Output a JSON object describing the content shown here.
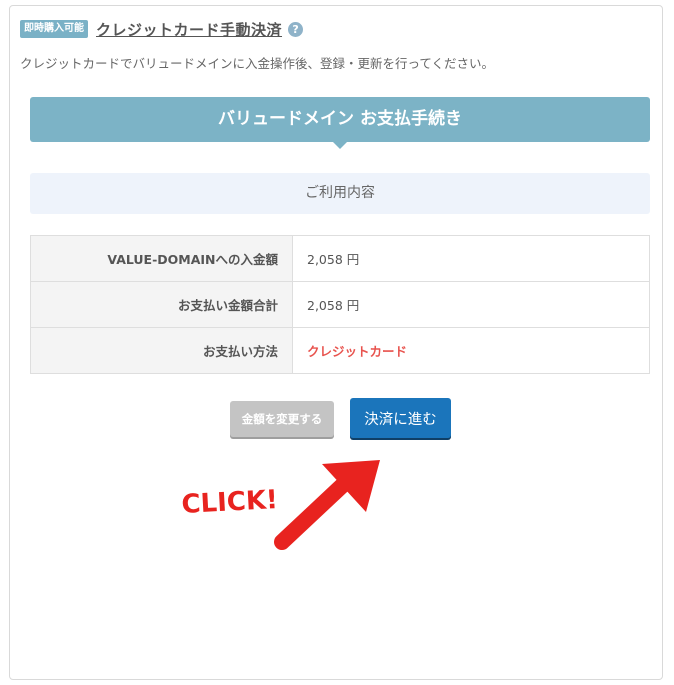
{
  "header": {
    "badge": "即時購入可能",
    "title": "クレジットカード手動決済",
    "help": "?"
  },
  "description": "クレジットカードでバリュードメインに入金操作後、登録・更新を行ってください。",
  "banner": {
    "title": "バリュードメイン お支払手続き"
  },
  "section": {
    "title": "ご利用内容"
  },
  "table": {
    "rows": [
      {
        "label": "VALUE-DOMAINへの入金額",
        "value": "2,058 円"
      },
      {
        "label": "お支払い金額合計",
        "value": "2,058 円"
      },
      {
        "label": "お支払い方法",
        "value": "クレジットカード"
      }
    ]
  },
  "buttons": {
    "change_amount": "金額を変更する",
    "proceed": "決済に進む"
  },
  "annotation": {
    "text": "CLICK!"
  },
  "colors": {
    "badge": "#7ab1c6",
    "banner": "#7cb3c6",
    "section_bg": "#eef3fb",
    "primary_button": "#1b75bb",
    "secondary_button": "#c4c4c4",
    "payment_method_text": "#e8534e",
    "arrow": "#e8231f"
  }
}
